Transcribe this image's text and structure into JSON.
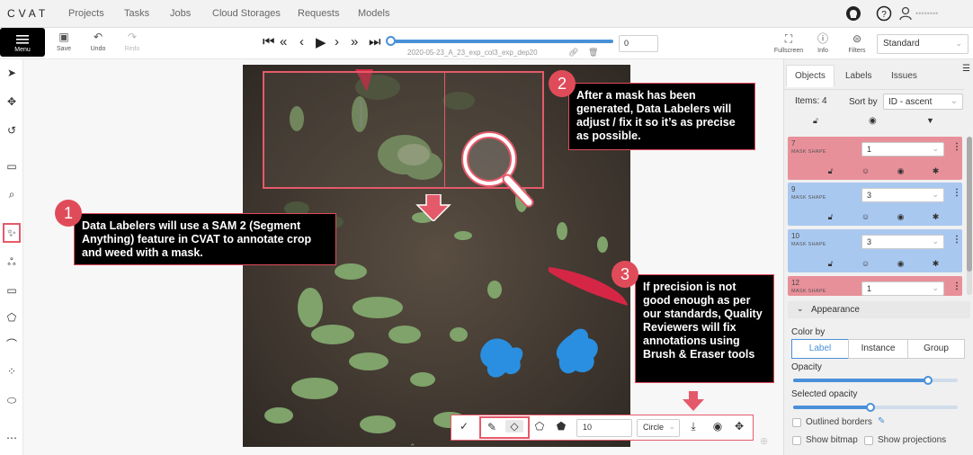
{
  "nav": {
    "logo": "CVAT",
    "items": [
      "Projects",
      "Tasks",
      "Jobs",
      "Cloud Storages",
      "Requests",
      "Models"
    ],
    "user": "••••••••"
  },
  "toolbar": {
    "menu_label": "Menu",
    "save_label": "Save",
    "undo_label": "Undo",
    "redo_label": "Redo",
    "frame_value": "0",
    "frame_name": "2020-05-23_A_23_exp_col3_exp_dep20",
    "fullscreen_label": "Fullscreen",
    "info_label": "Info",
    "filters_label": "Filters",
    "workspace_value": "Standard"
  },
  "callouts": [
    {
      "number": "1",
      "text": "Data Labelers will use a SAM 2 (Segment Anything) feature in CVAT to annotate crop and weed with a mask."
    },
    {
      "number": "2",
      "text": "After a mask has been generated, Data Labelers will adjust / fix it so it’s as precise as possible."
    },
    {
      "number": "3",
      "text": "If precision is not good enough as per our standards, Quality Reviewers will fix annotations using Brush & Eraser tools"
    }
  ],
  "brush_tools": {
    "size_value": "10",
    "shape_value": "Circle"
  },
  "panel": {
    "tabs": [
      "Objects",
      "Labels",
      "Issues"
    ],
    "items_label": "Items: 4",
    "sort_label": "Sort by",
    "sort_value": "ID - ascent",
    "objects": [
      {
        "id": "7",
        "type": "MASK SHAPE",
        "label": "1",
        "color": "#e8909a"
      },
      {
        "id": "9",
        "type": "MASK SHAPE",
        "label": "3",
        "color": "#a9c8f0"
      },
      {
        "id": "10",
        "type": "MASK SHAPE",
        "label": "3",
        "color": "#a9c8f0"
      },
      {
        "id": "12",
        "type": "MASK SHAPE",
        "label": "1",
        "color": "#e8909a"
      }
    ],
    "appearance_title": "Appearance",
    "color_by_label": "Color by",
    "color_by_options": [
      "Label",
      "Instance",
      "Group"
    ],
    "opacity_label": "Opacity",
    "opacity_value": 0.82,
    "selected_opacity_label": "Selected opacity",
    "selected_opacity_value": 0.47,
    "outlined_borders_label": "Outlined borders",
    "show_bitmap_label": "Show bitmap",
    "show_projections_label": "Show projections"
  }
}
